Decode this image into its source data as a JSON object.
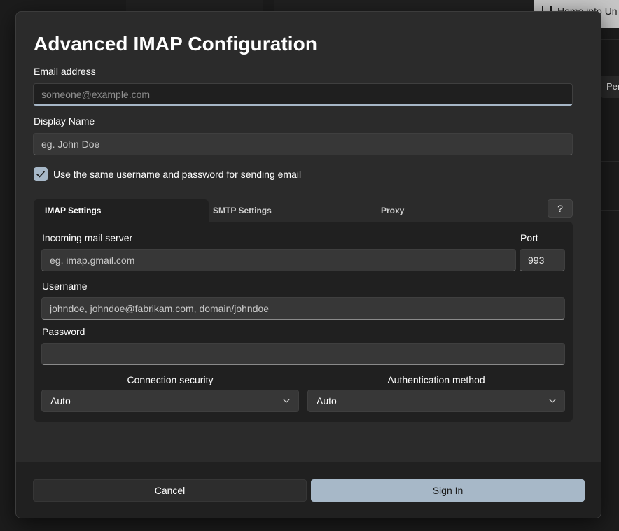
{
  "background": {
    "top_button_label": "Home into Un",
    "side_text": "Per"
  },
  "dialog": {
    "title": "Advanced IMAP Configuration",
    "email": {
      "label": "Email address",
      "placeholder": "someone@example.com",
      "value": ""
    },
    "display_name": {
      "label": "Display Name",
      "placeholder": "eg. John Doe",
      "value": ""
    },
    "same_credentials": {
      "label": "Use the same username and password for sending email",
      "checked": true
    },
    "tabs": [
      {
        "label": "IMAP Settings",
        "active": true
      },
      {
        "label": "SMTP Settings",
        "active": false
      },
      {
        "label": "Proxy",
        "active": false
      }
    ],
    "help_label": "?",
    "imap": {
      "server": {
        "label": "Incoming mail server",
        "placeholder": "eg. imap.gmail.com",
        "value": ""
      },
      "port": {
        "label": "Port",
        "value": "993"
      },
      "username": {
        "label": "Username",
        "placeholder": "johndoe, johndoe@fabrikam.com, domain/johndoe",
        "value": ""
      },
      "password": {
        "label": "Password",
        "value": ""
      },
      "security": {
        "label": "Connection security",
        "value": "Auto"
      },
      "auth": {
        "label": "Authentication method",
        "value": "Auto"
      }
    },
    "footer": {
      "cancel_label": "Cancel",
      "signin_label": "Sign In"
    }
  },
  "colors": {
    "accent": "#a7b8c8",
    "dialog_bg": "#2b2b2b",
    "panel_bg": "#202020"
  },
  "icons": {
    "checkbox": "checkmark-icon",
    "combo": "chevron-down-icon",
    "home": "home-icon"
  }
}
